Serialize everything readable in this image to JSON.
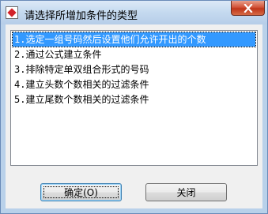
{
  "window": {
    "title": "请选择所增加条件的类型",
    "icon": "app-icon",
    "close_icon": "close-icon"
  },
  "list": {
    "items": [
      "1.选定一组号码然后设置他们允许开出的个数",
      "2.通过公式建立条件",
      "3.排除特定单双组合形式的号码",
      "4.建立头数个数相关的过滤条件",
      "5.建立尾数个数相关的过滤条件"
    ],
    "selected_index": 0
  },
  "buttons": {
    "ok_label": "确定(O)",
    "close_label": "关闭"
  },
  "colors": {
    "selection": "#3399ff",
    "titlebar": "#c4d9ef",
    "close_button": "#c0361a"
  }
}
